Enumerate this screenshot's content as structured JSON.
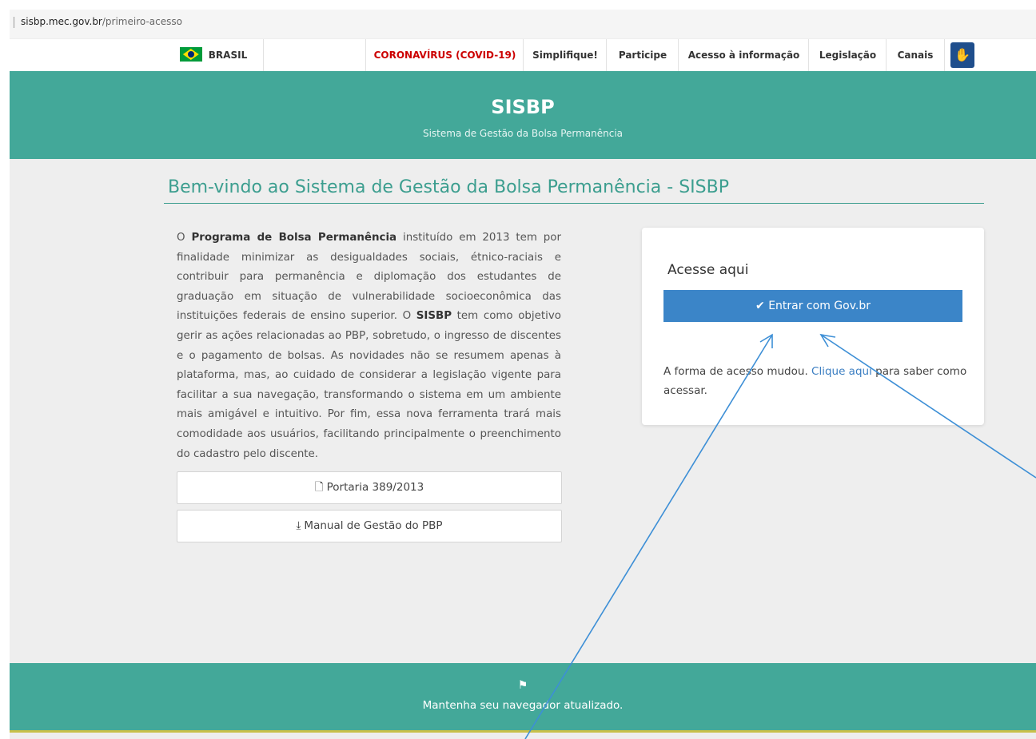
{
  "browser": {
    "url_host": "sisbp.mec.gov.br",
    "url_path": "/primeiro-acesso"
  },
  "govbar": {
    "brasil": "BRASIL",
    "items": [
      "CORONAVÍRUS (COVID-19)",
      "Simplifique!",
      "Participe",
      "Acesso à informação",
      "Legislação",
      "Canais"
    ],
    "accessibility_icon": "vlibras-hands-icon"
  },
  "header": {
    "title": "SISBP",
    "subtitle": "Sistema de Gestão da Bolsa Permanência"
  },
  "main": {
    "welcome": "Bem-vindo ao Sistema de Gestão da Bolsa Permanência - SISBP",
    "intro": {
      "p1": "O ",
      "program": "Programa de Bolsa Permanência",
      "p2": " instituído em 2013 tem por finalidade minimizar as desigualdades sociais, étnico-raciais e contribuir para permanência e diplomação dos estudantes de graduação em situação de vulnerabilidade socioeconômica das instituições federais de ensino superior. O ",
      "sisbp": "SISBP",
      "p3": " tem como objetivo gerir as ações relacionadas ao PBP, sobretudo, o ingresso de discentes e o pagamento de bolsas. As novidades não se resumem apenas à plataforma, mas, ao cuidado de considerar a legislação vigente para facilitar a sua navegação, transformando o sistema em um ambiente mais amigável e intuitivo. Por fim, essa nova ferramenta trará mais comodidade aos usuários, facilitando principalmente o preenchimento do cadastro pelo discente."
    },
    "buttons": {
      "portaria": "Portaria 389/2013",
      "manual": "Manual de Gestão do PBP"
    }
  },
  "login_card": {
    "title": "Acesse aqui",
    "button": "Entrar com Gov.br",
    "note_before": "A forma de acesso mudou. ",
    "note_link": "Clique aqui",
    "note_after": " para saber como acessar."
  },
  "footer": {
    "icon": "flag-icon",
    "message": "Mantenha seu navegador atualizado."
  },
  "colors": {
    "teal": "#43a899",
    "heading": "#3c9e8f",
    "button_blue": "#3b85c8",
    "link": "#3b7ec2",
    "covid_red": "#cc0000",
    "annotation_arrow": "#3d8fd6"
  }
}
